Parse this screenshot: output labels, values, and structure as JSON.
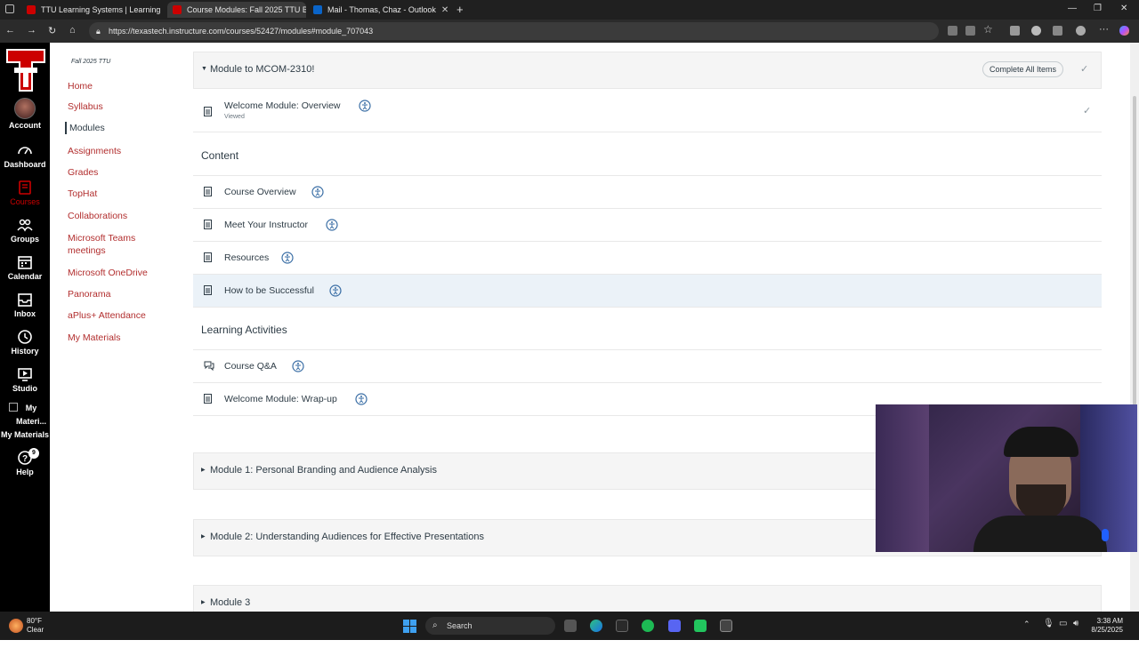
{
  "browser": {
    "tabs": [
      {
        "label": "TTU Learning Systems | Learning"
      },
      {
        "label": "Course Modules: Fall 2025 TTU B"
      },
      {
        "label": "Mail - Thomas, Chaz - Outlook"
      }
    ],
    "url": "https://texastech.instructure.com/courses/52427/modules#module_707043"
  },
  "global_nav": {
    "items": [
      {
        "label": "Account",
        "icon": "account-avatar"
      },
      {
        "label": "Dashboard",
        "icon": "dashboard-icon"
      },
      {
        "label": "Courses",
        "icon": "courses-icon"
      },
      {
        "label": "Groups",
        "icon": "groups-icon"
      },
      {
        "label": "Calendar",
        "icon": "calendar-icon"
      },
      {
        "label": "Inbox",
        "icon": "inbox-icon"
      },
      {
        "label": "History",
        "icon": "history-icon"
      },
      {
        "label": "Studio",
        "icon": "studio-icon"
      },
      {
        "label": "My Materi...",
        "label2": "My Materials",
        "icon": "my-materials-icon"
      },
      {
        "label": "Help",
        "icon": "help-icon",
        "badge": "9"
      }
    ],
    "active_color": "#cc0000"
  },
  "course_nav": {
    "term": "Fall 2025 TTU",
    "items": [
      "Home",
      "Syllabus",
      "Modules",
      "Assignments",
      "Grades",
      "TopHat",
      "Collaborations",
      "Microsoft Teams meetings",
      "Microsoft OneDrive",
      "Panorama",
      "aPlus+ Attendance",
      "My Materials"
    ],
    "link_color": "#b22e2e"
  },
  "module0": {
    "title": "Module to MCOM-2310!",
    "complete_label": "Complete All Items",
    "welcome": {
      "title": "Welcome Module: Overview",
      "status": "Viewed"
    },
    "content_header": "Content",
    "content_items": [
      "Course Overview",
      "Meet Your Instructor",
      "Resources",
      "How to be Successful"
    ],
    "activities_header": "Learning Activities",
    "activity_items": [
      "Course Q&A",
      "Welcome Module: Wrap-up"
    ]
  },
  "modules": [
    {
      "title": "Module 1: Personal Branding and Audience Analysis"
    },
    {
      "title": "Module 2: Understanding Audiences for Effective Presentations"
    },
    {
      "title": "Module 3"
    }
  ],
  "taskbar": {
    "weather_temp": "80°F",
    "weather_desc": "Clear",
    "search": "Search",
    "time": "3:38 AM",
    "date": "8/25/2025"
  }
}
